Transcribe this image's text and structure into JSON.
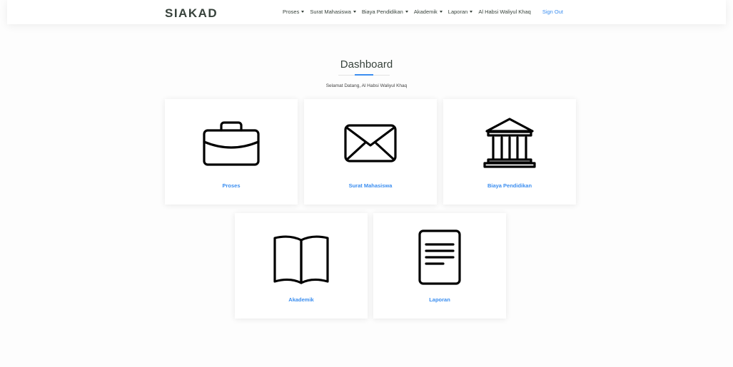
{
  "header": {
    "brand": "SIAKAD",
    "nav": [
      {
        "label": "Proses",
        "dropdown": true
      },
      {
        "label": "Surat Mahasiswa",
        "dropdown": true
      },
      {
        "label": "Biaya Pendidikan",
        "dropdown": true
      },
      {
        "label": "Akademik",
        "dropdown": true
      },
      {
        "label": "Laporan",
        "dropdown": true
      }
    ],
    "user_name": "Al Habsi Waliyul Khaq",
    "sign_out": "Sign Out"
  },
  "main": {
    "title": "Dashboard",
    "welcome": "Selamat Datang, Al Habsi Waliyul Khaq",
    "cards": [
      {
        "label": "Proses",
        "icon": "briefcase-icon"
      },
      {
        "label": "Surat Mahasiswa",
        "icon": "envelope-icon"
      },
      {
        "label": "Biaya Pendidikan",
        "icon": "bank-icon"
      },
      {
        "label": "Akademik",
        "icon": "book-icon"
      },
      {
        "label": "Laporan",
        "icon": "document-icon"
      }
    ]
  },
  "colors": {
    "accent": "#3b8ef0",
    "text": "#37423b",
    "background": "#fdfdfd"
  }
}
